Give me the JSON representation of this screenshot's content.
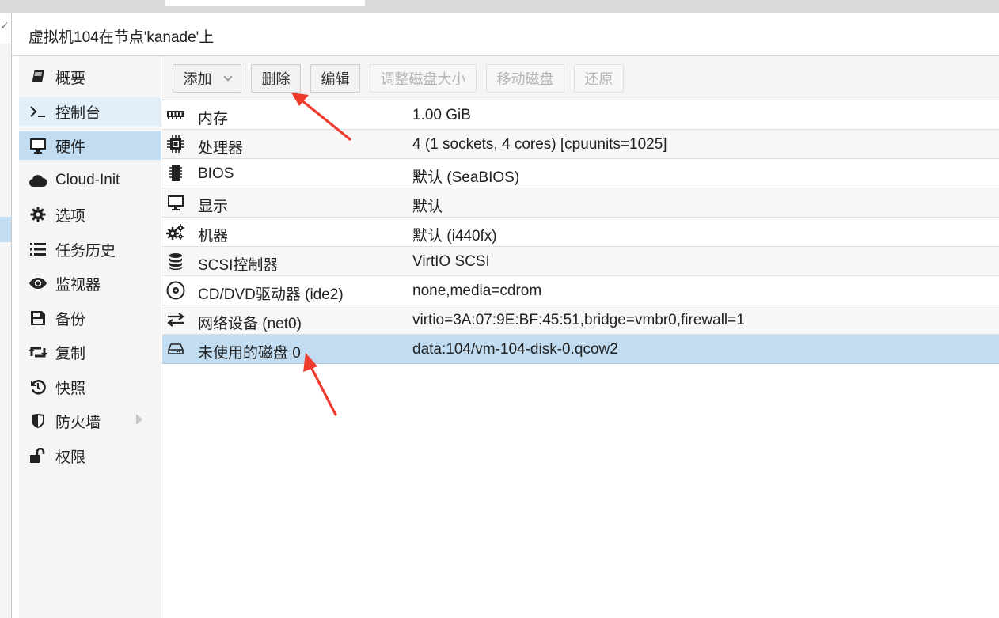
{
  "window": {
    "title": "虚拟机104在节点'kanade'上"
  },
  "nav": {
    "items": [
      {
        "label": "概要",
        "icon": "book-icon",
        "state": "normal"
      },
      {
        "label": "控制台",
        "icon": "terminal-icon",
        "state": "hover"
      },
      {
        "label": "硬件",
        "icon": "desktop-icon",
        "state": "active"
      },
      {
        "label": "Cloud-Init",
        "icon": "cloud-icon",
        "state": "normal"
      },
      {
        "label": "选项",
        "icon": "gear-icon",
        "state": "normal"
      },
      {
        "label": "任务历史",
        "icon": "list-icon",
        "state": "normal"
      },
      {
        "label": "监视器",
        "icon": "eye-icon",
        "state": "normal"
      },
      {
        "label": "备份",
        "icon": "floppy-icon",
        "state": "normal"
      },
      {
        "label": "复制",
        "icon": "retweet-icon",
        "state": "normal"
      },
      {
        "label": "快照",
        "icon": "history-icon",
        "state": "normal"
      },
      {
        "label": "防火墙",
        "icon": "shield-icon",
        "state": "normal",
        "has_submenu": true
      },
      {
        "label": "权限",
        "icon": "unlock-icon",
        "state": "normal"
      }
    ]
  },
  "toolbar": {
    "add_label": "添加",
    "remove_label": "删除",
    "edit_label": "编辑",
    "resize_label": "调整磁盘大小",
    "move_label": "移动磁盘",
    "revert_label": "还原"
  },
  "hardware": {
    "rows": [
      {
        "name": "内存",
        "value": "1.00 GiB",
        "icon": "memory-icon"
      },
      {
        "name": "处理器",
        "value": "4 (1 sockets, 4 cores) [cpuunits=1025]",
        "icon": "cpu-icon"
      },
      {
        "name": "BIOS",
        "value": "默认 (SeaBIOS)",
        "icon": "microchip-icon"
      },
      {
        "name": "显示",
        "value": "默认",
        "icon": "desktop-icon"
      },
      {
        "name": "机器",
        "value": "默认 (i440fx)",
        "icon": "cogs-icon"
      },
      {
        "name": "SCSI控制器",
        "value": "VirtIO SCSI",
        "icon": "database-icon"
      },
      {
        "name": "CD/DVD驱动器 (ide2)",
        "value": "none,media=cdrom",
        "icon": "cdrom-icon"
      },
      {
        "name": "网络设备 (net0)",
        "value": "virtio=3A:07:9E:BF:45:51,bridge=vmbr0,firewall=1",
        "icon": "exchange-icon"
      },
      {
        "name": "未使用的磁盘 0",
        "value": "data:104/vm-104-disk-0.qcow2",
        "icon": "hdd-icon",
        "selected": true
      }
    ]
  },
  "colors": {
    "selection": "#c2ddf2",
    "hover": "#e2eef8",
    "annotation_arrow": "#f03a2e"
  }
}
